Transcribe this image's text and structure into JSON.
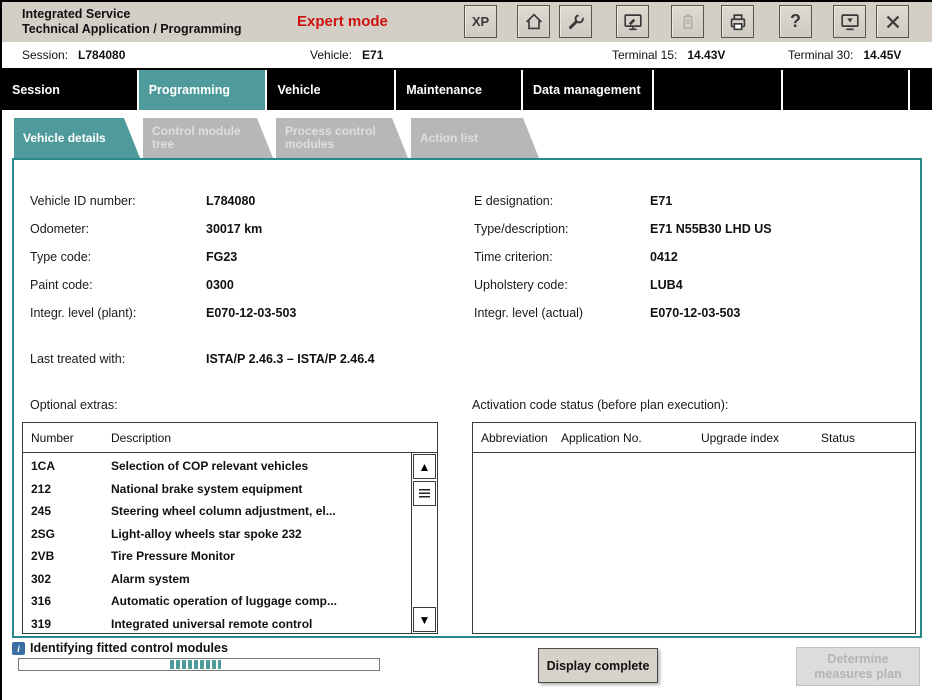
{
  "header": {
    "title_line1": "Integrated Service",
    "title_line2": "Technical Application / Programming",
    "mode_label": "Expert mode",
    "xp_button": "XP",
    "help_glyph": "?"
  },
  "status_bar": {
    "session_label": "Session:",
    "session_value": "L784080",
    "vehicle_label": "Vehicle:",
    "vehicle_value": "E71",
    "terminal15_label": "Terminal 15:",
    "terminal15_value": "14.43V",
    "terminal30_label": "Terminal 30:",
    "terminal30_value": "14.45V"
  },
  "nav": {
    "tabs": [
      {
        "label": "Session",
        "active": false
      },
      {
        "label": "Programming",
        "active": true
      },
      {
        "label": "Vehicle",
        "active": false
      },
      {
        "label": "Maintenance",
        "active": false
      },
      {
        "label": "Data management",
        "active": false
      }
    ]
  },
  "subtabs": [
    {
      "label": "Vehicle details",
      "state": "active"
    },
    {
      "label": "Control module tree",
      "state": "disabled"
    },
    {
      "label": "Process control modules",
      "state": "disabled"
    },
    {
      "label": "Action list",
      "state": "disabled"
    }
  ],
  "vehicle_details": {
    "fields_left": [
      {
        "label": "Vehicle ID number:",
        "value": "L784080"
      },
      {
        "label": "Odometer:",
        "value": "30017 km"
      },
      {
        "label": "Type code:",
        "value": "FG23"
      },
      {
        "label": "Paint code:",
        "value": "0300"
      },
      {
        "label": "Integr. level (plant):",
        "value": "E070-12-03-503"
      },
      {
        "label": "Last treated with:",
        "value": "ISTA/P 2.46.3 – ISTA/P 2.46.4"
      }
    ],
    "fields_right": [
      {
        "label": "E designation:",
        "value": "E71"
      },
      {
        "label": "Type/description:",
        "value": "E71 N55B30 LHD US"
      },
      {
        "label": "Time criterion:",
        "value": "0412"
      },
      {
        "label": "Upholstery code:",
        "value": "LUB4"
      },
      {
        "label": "Integr. level (actual)",
        "value": "E070-12-03-503"
      }
    ]
  },
  "optional_extras": {
    "title": "Optional extras:",
    "headers": [
      "Number",
      "Description"
    ],
    "rows": [
      {
        "number": "1CA",
        "description": "Selection of COP relevant vehicles"
      },
      {
        "number": "212",
        "description": "National brake system equipment"
      },
      {
        "number": "245",
        "description": "Steering wheel column adjustment, el..."
      },
      {
        "number": "2SG",
        "description": "Light-alloy wheels star spoke 232"
      },
      {
        "number": "2VB",
        "description": "Tire Pressure Monitor"
      },
      {
        "number": "302",
        "description": "Alarm system"
      },
      {
        "number": "316",
        "description": "Automatic operation of luggage comp..."
      },
      {
        "number": "319",
        "description": "Integrated universal remote control"
      }
    ]
  },
  "activation": {
    "title": "Activation code status (before plan execution):",
    "headers": [
      "Abbreviation",
      "Application No.",
      "Upgrade index",
      "Status"
    ],
    "rows": []
  },
  "footer": {
    "status_text": "Identifying fitted control modules",
    "progress_indeterminate": true,
    "display_complete": "Display complete",
    "determine": "Determine measures plan"
  },
  "icons": {
    "up_arrow": "▲",
    "down_arrow": "▼",
    "info_glyph": "i"
  },
  "colors": {
    "accent_teal": "#4f9a9a",
    "expert_red": "#cf1210",
    "panel_border": "#2a8a8a"
  }
}
